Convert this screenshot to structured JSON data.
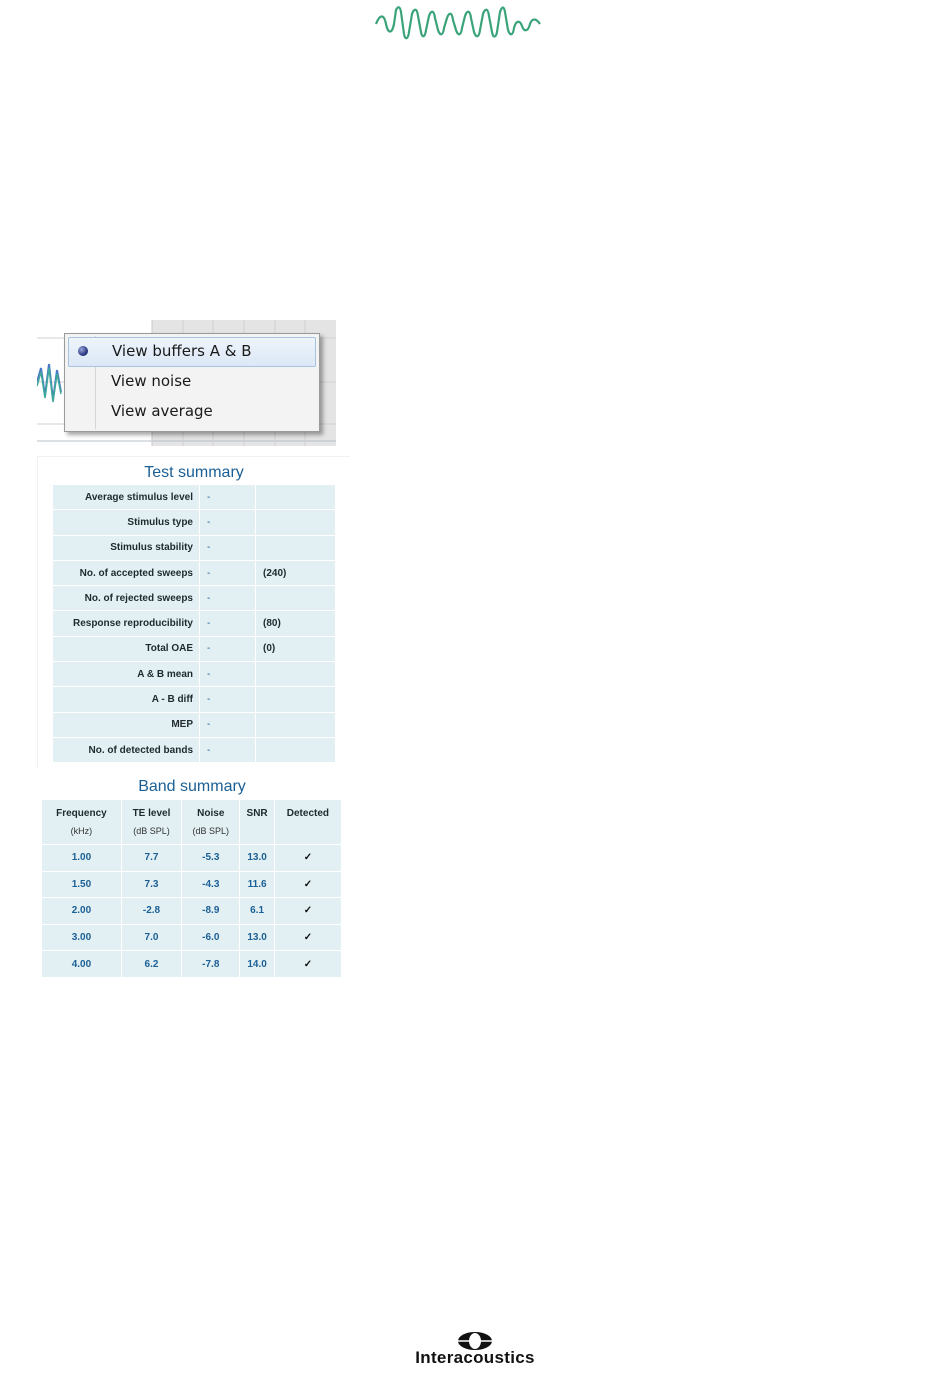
{
  "context_menu": {
    "items": [
      {
        "label": "View buffers A & B",
        "selected": true
      },
      {
        "label": "View noise",
        "selected": false
      },
      {
        "label": "View average",
        "selected": false
      }
    ]
  },
  "test_summary": {
    "title": "Test summary",
    "rows": [
      {
        "label": "Average stimulus level",
        "value": "-",
        "extra": ""
      },
      {
        "label": "Stimulus type",
        "value": "-",
        "extra": ""
      },
      {
        "label": "Stimulus stability",
        "value": "-",
        "extra": ""
      },
      {
        "label": "No. of accepted sweeps",
        "value": "-",
        "extra": "(240)"
      },
      {
        "label": "No. of rejected sweeps",
        "value": "-",
        "extra": ""
      },
      {
        "label": "Response reproducibility",
        "value": "-",
        "extra": "(80)"
      },
      {
        "label": "Total OAE",
        "value": "-",
        "extra": "(0)"
      },
      {
        "label": "A & B mean",
        "value": "-",
        "extra": ""
      },
      {
        "label": "A - B diff",
        "value": "-",
        "extra": ""
      },
      {
        "label": "MEP",
        "value": "-",
        "extra": ""
      },
      {
        "label": "No. of detected bands",
        "value": "-",
        "extra": ""
      }
    ]
  },
  "band_summary": {
    "title": "Band summary",
    "columns": [
      {
        "name": "Frequency",
        "unit": "(kHz)"
      },
      {
        "name": "TE level",
        "unit": "(dB SPL)"
      },
      {
        "name": "Noise",
        "unit": "(dB SPL)"
      },
      {
        "name": "SNR",
        "unit": ""
      },
      {
        "name": "Detected",
        "unit": ""
      }
    ],
    "rows": [
      [
        "1.00",
        "7.7",
        "-5.3",
        "13.0",
        "✓"
      ],
      [
        "1.50",
        "7.3",
        "-4.3",
        "11.6",
        "✓"
      ],
      [
        "2.00",
        "-2.8",
        "-8.9",
        "6.1",
        "✓"
      ],
      [
        "3.00",
        "7.0",
        "-6.0",
        "13.0",
        "✓"
      ],
      [
        "4.00",
        "6.2",
        "-7.8",
        "14.0",
        "✓"
      ]
    ]
  },
  "footer": {
    "brand": "Interacoustics"
  },
  "colors": {
    "accent": "#1b5f95",
    "table_bg": "#e2f0f3",
    "logo_green": "#3aa37a"
  }
}
